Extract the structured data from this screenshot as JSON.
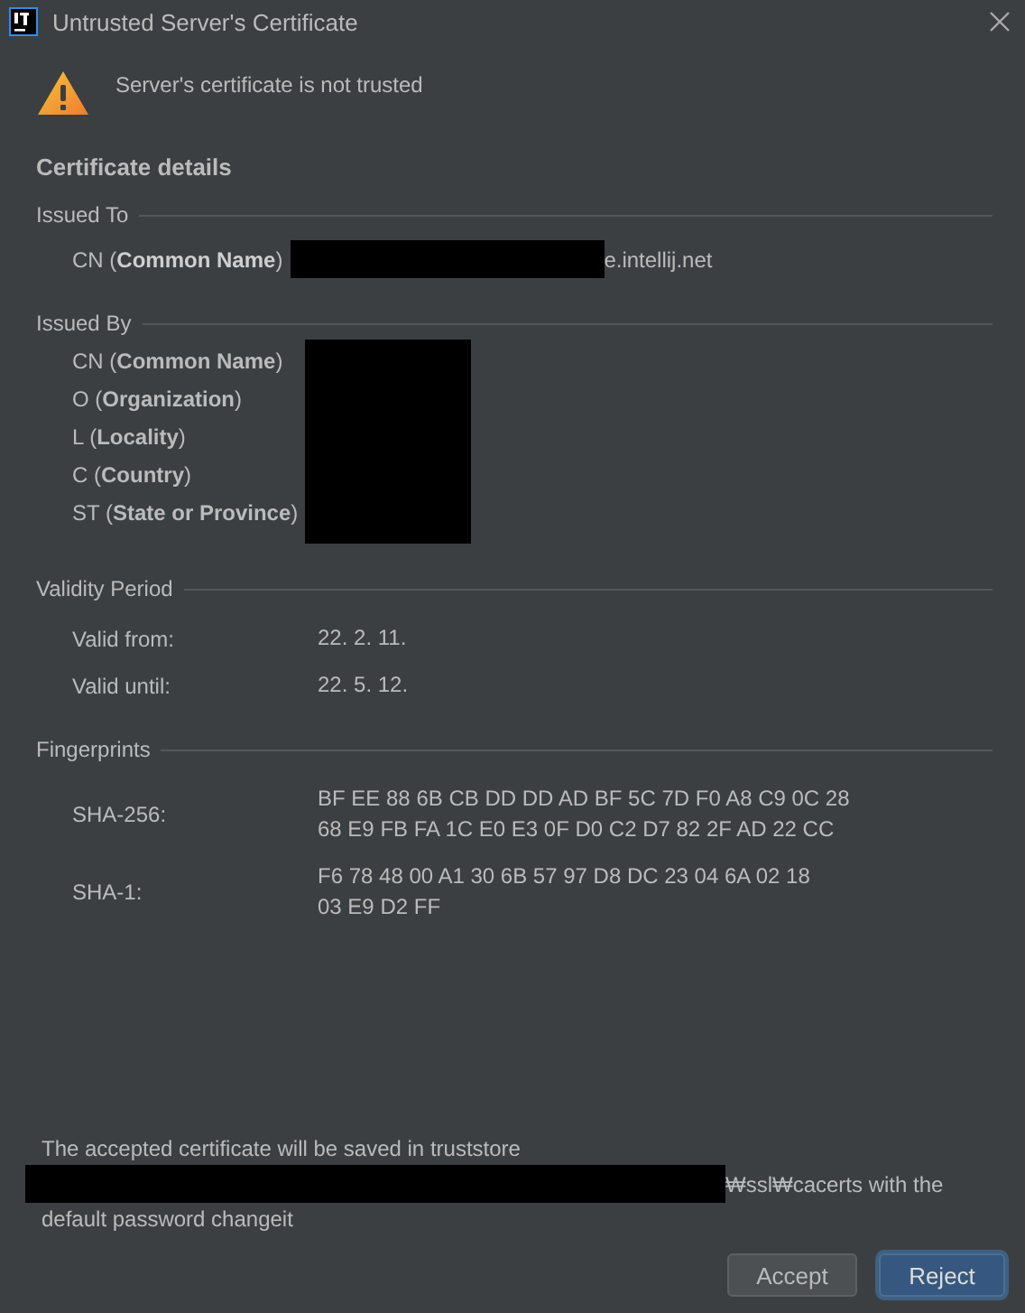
{
  "window": {
    "title": "Untrusted Server's Certificate"
  },
  "warning": {
    "message": "Server's certificate is not trusted"
  },
  "details_title": "Certificate details",
  "issued_to": {
    "title": "Issued To",
    "fields": [
      {
        "label": "CN (**Common Name**)",
        "value_redacted": true,
        "value": "e.intellij.net"
      }
    ]
  },
  "issued_by": {
    "title": "Issued By",
    "values_redacted": true,
    "fields": [
      {
        "label": "CN (**Common Name**)"
      },
      {
        "label": "O (**Organization**)"
      },
      {
        "label": "L (**Locality**)"
      },
      {
        "label": "C (**Country**)"
      },
      {
        "label": "ST (**State or Province**)"
      }
    ]
  },
  "validity": {
    "title": "Validity Period",
    "rows": [
      {
        "label": "Valid from:",
        "lines": [
          "22. 2. 11."
        ]
      },
      {
        "label": "Valid until:",
        "lines": [
          "22. 5. 12."
        ]
      }
    ]
  },
  "fingerprints": {
    "title": "Fingerprints",
    "rows": [
      {
        "label": "SHA-256:",
        "lines": [
          "BF EE 88 6B CB DD DD AD BF 5C 7D F0 A8 C9 0C 28",
          "68 E9 FB FA 1C E0 E3 0F D0 C2 D7 82 2F AD 22 CC"
        ]
      },
      {
        "label": "SHA-1:",
        "lines": [
          "F6 78 48 00 A1 30 6B 57 97 D8 DC 23 04 6A 02 18",
          "03 E9 D2 FF"
        ]
      }
    ]
  },
  "truststore_note": {
    "line_1": "The accepted certificate will be saved in truststore",
    "path_redacted": true,
    "line_2_tail": "₩ssl₩cacerts with the",
    "line_3": "default password changeit"
  },
  "buttons": [
    {
      "label": "Accept",
      "default": false
    },
    {
      "label": "Reject",
      "default": true
    }
  ]
}
